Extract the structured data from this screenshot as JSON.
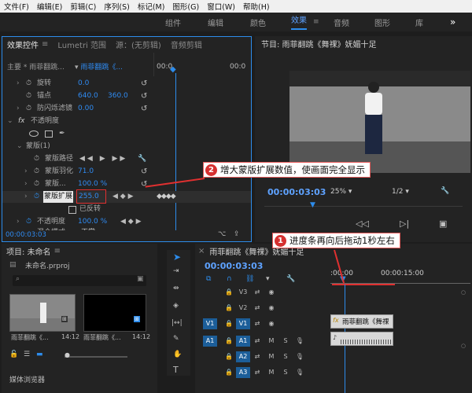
{
  "menu": {
    "items": [
      "文件(F)",
      "编辑(E)",
      "剪辑(C)",
      "序列(S)",
      "标记(M)",
      "图形(G)",
      "窗口(W)",
      "帮助(H)"
    ]
  },
  "workspace": {
    "tabs": [
      "组件",
      "编辑",
      "颜色",
      "效果",
      "音频",
      "图形",
      "库"
    ],
    "more": "»"
  },
  "effect_controls": {
    "tabs": [
      "效果控件",
      "Lumetri 范围",
      "源：(无剪辑)",
      "音频剪辑"
    ],
    "main_label": "主要 * 雨菲翻跳...",
    "clip_label": "雨菲翻跳《...",
    "ruler_time": "00:0",
    "ruler_time_right": "00:0",
    "rows": {
      "rotation": "旋转",
      "rotation_val": "0.0",
      "anchor": "锚点",
      "anchor_x": "640.0",
      "anchor_y": "360.0",
      "anti_flicker": "防闪烁滤镜",
      "anti_flicker_val": "0.00",
      "opacity": "不透明度",
      "mask": "蒙版(1)",
      "mask_path": "蒙版路径",
      "mask_feather": "蒙版羽化",
      "mask_feather_val": "71.0",
      "mask_opacity": "蒙版...",
      "mask_opacity_val": "100.0 %",
      "mask_expand": "蒙版扩展",
      "mask_expand_val": "255.0",
      "inverted": "已反转",
      "opacity2": "不透明度",
      "opacity2_val": "100.0 %",
      "blend": "混合模式",
      "blend_val": "正常"
    },
    "timecode": "00:00:03:03"
  },
  "program": {
    "title": "节目: 雨菲翻跳《舞祼》妩媚十足",
    "timecode": "00:00:03:03",
    "zoom": "25%",
    "resolution": "1/2"
  },
  "project": {
    "title": "项目: 未命名",
    "filename": "未命名.prproj",
    "clip1_name": "雨菲翻跳《...",
    "clip1_dur": "14:12",
    "clip2_name": "雨菲翻跳《...",
    "clip2_dur": "14:12",
    "media_browser": "媒体浏览器"
  },
  "timeline": {
    "title": "雨菲翻跳《舞祼》妩媚十足",
    "timecode": "00:00:03:03",
    "ruler_start": ":00:00",
    "ruler_mid": "00:00:15:00",
    "v3": "V3",
    "v2": "V2",
    "v1": "V1",
    "a1": "A1",
    "a2": "A2",
    "a3": "A3",
    "clip_label": "雨菲翻跳《舞祼",
    "m": "M",
    "s": "S"
  },
  "annotations": {
    "a1_num": "1",
    "a1_text": "进度条再向后拖动1秒左右",
    "a2_num": "2",
    "a2_text": "增大蒙版扩展数值，使画面完全显示"
  },
  "colors": {
    "accent": "#2d8ceb",
    "annotation": "#e03030",
    "value_blue": "#2f8bf2"
  }
}
